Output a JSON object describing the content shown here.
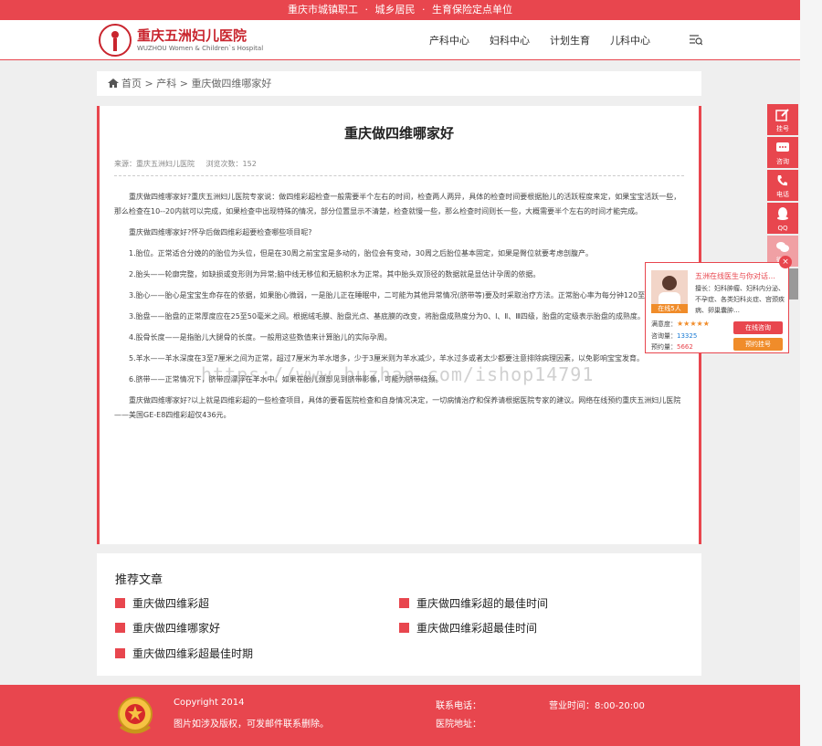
{
  "topbar": {
    "text1": "重庆市城镇职工",
    "sep": "·",
    "text2": "城乡居民",
    "text3": "生育保险定点单位"
  },
  "logo": {
    "cn": "重庆五洲妇儿医院",
    "en": "WUZHOU Women & Children`s Hospital"
  },
  "nav": {
    "items": [
      "产科中心",
      "妇科中心",
      "计划生育",
      "儿科中心"
    ]
  },
  "breadcrumb": {
    "home": "首页",
    "sep1": " > ",
    "level1": "产科",
    "sep2": " > ",
    "current": "重庆做四维哪家好"
  },
  "article": {
    "title": "重庆做四维哪家好",
    "source": "来源：重庆五洲妇儿医院",
    "views": "浏览次数：152",
    "paragraphs": [
      "重庆做四维哪家好?重庆五洲妇儿医院专家说：做四维彩超检查一般需要半个左右的时间，检查两人两异，具体的检查时间要根据胎儿的活跃程度来定，如果宝宝活跃一些，那么检查在10--20内就可以完成，如果检查中出现特殊的情况，部分位置显示不清楚，检查就慢一些，那么检查时间则长一些，大概需要半个左右的时间才能完成。",
      "重庆做四维哪家好?怀孕后做四维彩超要检查哪些项目呢?",
      "1.胎位。正常适合分娩的的胎位为头位，但是在30周之前宝宝是多动的，胎位会有变动，30周之后胎位基本固定，如果是臀位就要考虑剖腹产。",
      "2.胎头——轮廓完整，如缺损或变形则为异常;脑中线无移位和无脑积水为正常。其中胎头双顶径的数据就是显估计孕周的依据。",
      "3.胎心——胎心是宝宝生命存在的依据，如果胎心微弱，一是胎儿正在睡眠中，二可能为其他异常情况(脐带等)要及时采取治疗方法。正常胎心率为每分钟120至160次。",
      "3.胎盘——胎盘的正常厚度应在25至50毫米之间。根据绒毛膜、胎盘光点、基底膜的改变，将胎盘成熟度分为0、Ⅰ、Ⅱ、Ⅲ四级，胎盘的定级表示胎盘的成熟度。",
      "4.股骨长度——是指胎儿大腿骨的长度。一般用这些数值来计算胎儿的实际孕周。",
      "5.羊水——羊水深度在3至7厘米之间为正常，超过7厘米为羊水增多，少于3厘米则为羊水减少，羊水过多或者太少都要注意排除病理因素，以免影响宝宝发育。",
      "6.脐带——正常情况下，脐带应漂浮在羊水中，如果在胎儿颈部见到脐带影像，可能为脐带绕颈。",
      "重庆做四维哪家好?以上就是四维彩超的一些检查项目，具体的要看医院检查和自身情况决定，一切病情治疗和保养请根据医院专家的建议。网络在线预约重庆五洲妇儿医院——美国GE-E8四维彩超仅436元。"
    ]
  },
  "recommend": {
    "title": "推荐文章",
    "items": [
      "重庆做四维彩超",
      "重庆做四维彩超的最佳时间",
      "重庆做四维哪家好",
      "重庆做四维彩超最佳时间",
      "重庆做四维彩超最佳时期"
    ]
  },
  "footer": {
    "copyright": "Copyright 2014",
    "note": "图片如涉及版权，可发邮件联系删除。",
    "tel": "联系电话：",
    "address": "医院地址：",
    "hours": "营业时间：8:00-20:00"
  },
  "side_tools": [
    {
      "label": "挂号",
      "icon": "edit-icon"
    },
    {
      "label": "咨询",
      "icon": "chat-icon"
    },
    {
      "label": "电话",
      "icon": "phone-icon"
    },
    {
      "label": "QQ",
      "icon": "qq-icon"
    },
    {
      "label": "微信",
      "icon": "wechat-icon"
    }
  ],
  "popup": {
    "close": "×",
    "name": "五洲在线医生与你对话…",
    "desc": "擅长：妇科肿瘤、妇科内分泌、不孕症、各类妇科炎症、宫颈疾病、卵巢囊肿…",
    "online": "在线5人",
    "satisfaction_label": "满意度：",
    "stars": "★★★★★",
    "consult_label": "咨询量：",
    "consult_count": "13325",
    "appoint_label": "预约量：",
    "appoint_count": "5662",
    "btn_consult": "在线咨询",
    "btn_book": "预约挂号"
  },
  "watermark": "https://www.huzhan.com/ishop14791",
  "colors": {
    "accent": "#e8464e",
    "orange": "#f08c2a",
    "link_blue": "#1a7bd4"
  }
}
